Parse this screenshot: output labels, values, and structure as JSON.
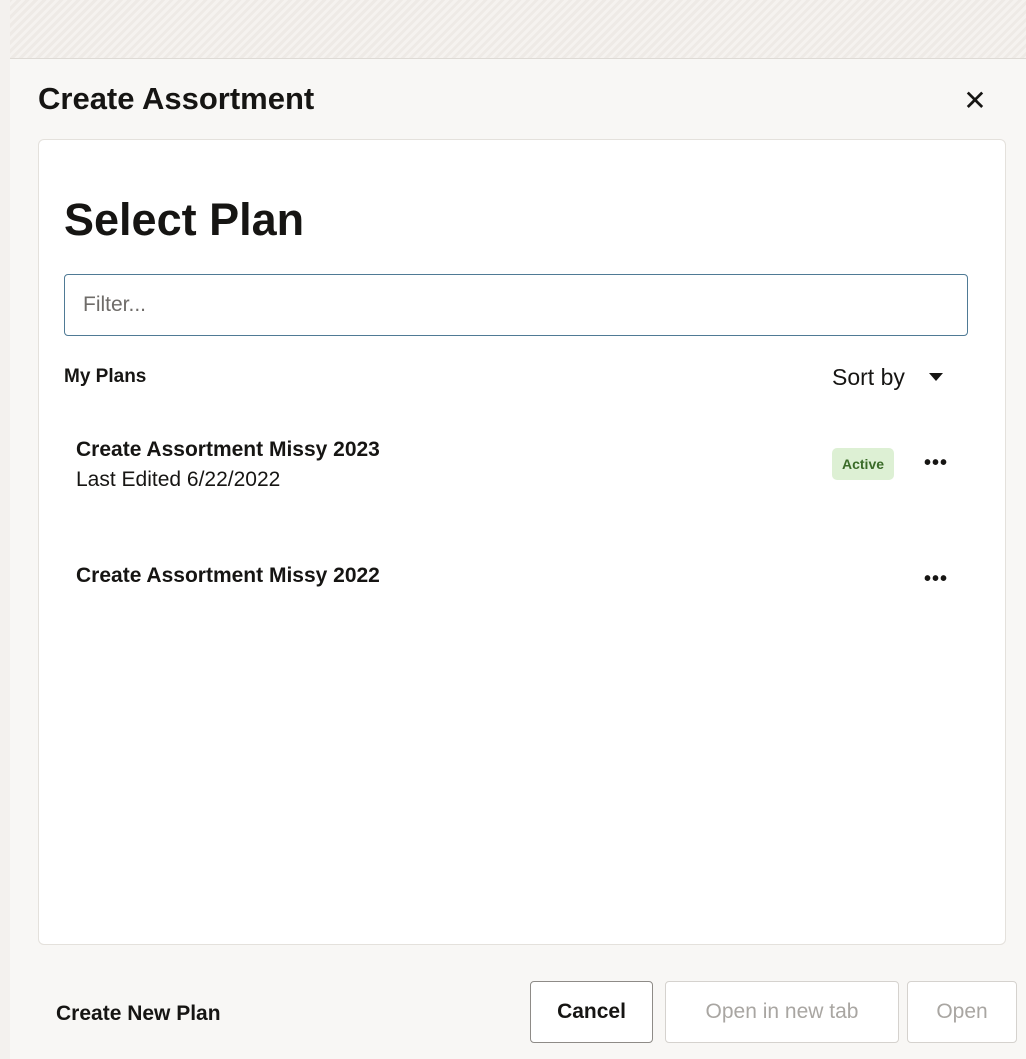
{
  "dialog": {
    "title": "Create Assortment",
    "close_icon": "close-icon"
  },
  "panel": {
    "heading": "Select Plan",
    "filter": {
      "placeholder": "Filter...",
      "value": ""
    },
    "section_label": "My Plans",
    "sort_label": "Sort by",
    "plans": [
      {
        "name": "Create Assortment Missy 2023",
        "subtitle": "Last Edited 6/22/2022",
        "badge": "Active",
        "more": "•••"
      },
      {
        "name": "Create Assortment Missy 2022",
        "more": "•••"
      }
    ]
  },
  "footer": {
    "create_new": "Create New Plan",
    "cancel": "Cancel",
    "open_new_tab": "Open in new tab",
    "open": "Open"
  },
  "colors": {
    "badge_bg": "#ddf0d4",
    "badge_text": "#3a6b28",
    "input_border": "#4f7a95",
    "disabled_text": "#a9a6a2"
  }
}
